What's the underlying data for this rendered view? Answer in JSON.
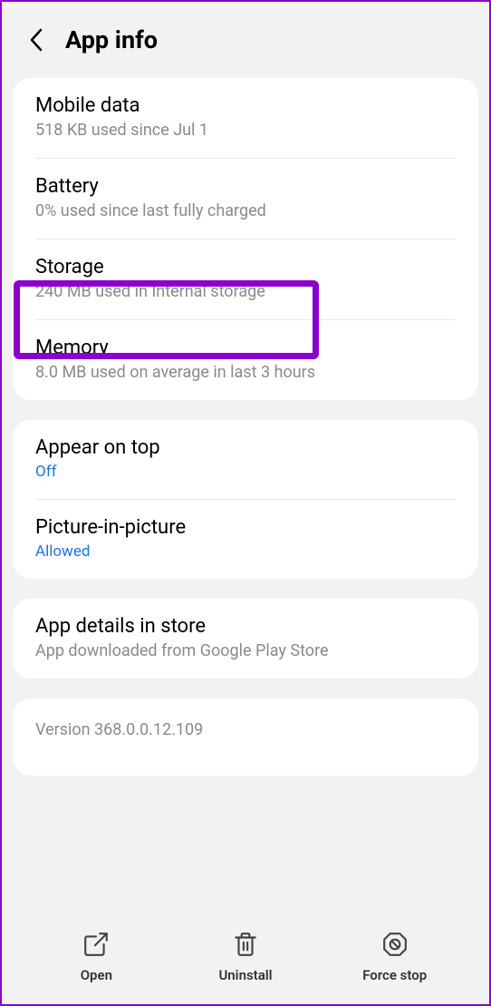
{
  "header": {
    "title": "App info"
  },
  "sections": {
    "usage": {
      "mobile_data": {
        "title": "Mobile data",
        "sub": "518 KB used since Jul 1"
      },
      "battery": {
        "title": "Battery",
        "sub": "0% used since last fully charged"
      },
      "storage": {
        "title": "Storage",
        "sub": "240 MB used in Internal storage"
      },
      "memory": {
        "title": "Memory",
        "sub": "8.0 MB used on average in last 3 hours"
      }
    },
    "permissions": {
      "appear_on_top": {
        "title": "Appear on top",
        "status": "Off"
      },
      "pip": {
        "title": "Picture-in-picture",
        "status": "Allowed"
      }
    },
    "store": {
      "title": "App details in store",
      "sub": "App downloaded from Google Play Store"
    },
    "version": "Version 368.0.0.12.109"
  },
  "bottom": {
    "open": "Open",
    "uninstall": "Uninstall",
    "force_stop": "Force stop"
  }
}
